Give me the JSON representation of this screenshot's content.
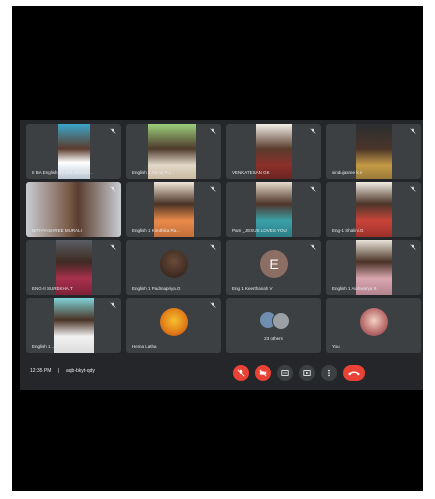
{
  "meeting": {
    "time": "12:35 PM",
    "code": "aqb-bkyt-qdy"
  },
  "tiles": [
    {
      "name": "II BA English (Aruna Malakel..."
    },
    {
      "name": "English 1 Sanoj R.(..."
    },
    {
      "name": "VENKATESAN GK"
    },
    {
      "name": "sindujasree k.s"
    },
    {
      "name": "NITHYASHREE MURALI"
    },
    {
      "name": "English 1 Kiruthika Ra..."
    },
    {
      "name": "Pam _JESUS LOVES YOU"
    },
    {
      "name": "Eng-1 Shalini.G"
    },
    {
      "name": "ENG-II SUREKHA.T"
    },
    {
      "name": "English 1 Padmapriya.G"
    },
    {
      "name": "Eng 1 Keerthanah V",
      "initial": "E"
    },
    {
      "name": "English 1 Aishwarya S"
    },
    {
      "name": "English 1 ..."
    },
    {
      "name": "Hema Latha"
    },
    {
      "name": "23 others"
    },
    {
      "name": "You"
    }
  ],
  "colors": {
    "accent_red": "#ea4335",
    "tile_bg": "#3c4043",
    "meet_bg": "#24262a"
  }
}
